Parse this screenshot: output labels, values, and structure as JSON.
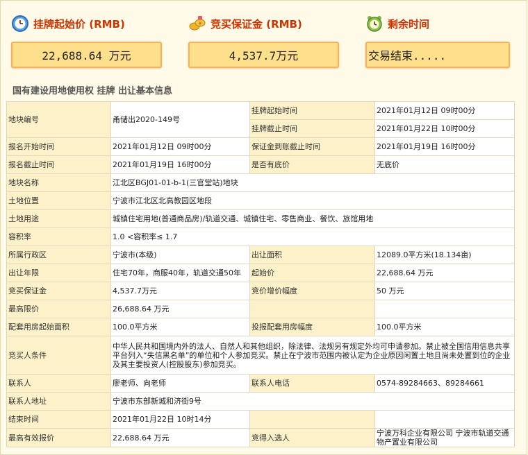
{
  "summary": {
    "start_price_title": "挂牌起始价 (RMB)",
    "start_price_value": "22,688.64 万元",
    "deposit_title": "竞买保证金 (RMB)",
    "deposit_value": "4,537.7万元",
    "remaining_time_title": "剩余时间",
    "remaining_time_value": "交易结束....."
  },
  "section_title": "国有建设用地使用权 挂牌 出让基本信息",
  "rows": {
    "parcel_no_label": "地块编号",
    "parcel_no": "甬储出2020-149号",
    "listing_start_label": "挂牌起始时间",
    "listing_start": "2021年01月12日 09时00分",
    "listing_end_label": "挂牌截止时间",
    "listing_end": "2021年01月22日 10时00分",
    "signup_start_label": "报名开始时间",
    "signup_start": "2021年01月12日 09时00分",
    "deposit_deadline_label": "保证金到账截止时间",
    "deposit_deadline": "2021年01月19日 16时00分",
    "signup_end_label": "报名截止时间",
    "signup_end": "2021年01月19日 16时00分",
    "reserve_label": "是否有底价",
    "reserve": "无底价",
    "parcel_name_label": "地块名称",
    "parcel_name": "江北区BGJ01-01-b-1(三官堂站)地块",
    "location_label": "土地位置",
    "location": "宁波市江北区北高教园区地段",
    "usage_label": "土地用途",
    "usage": "城镇住宅用地(普通商品房)/轨道交通、城镇住宅、零售商业、餐饮、旅馆用地",
    "far_label": "容积率",
    "far": "1.0 <容积率≤ 1.7",
    "district_label": "所属行政区",
    "district": "宁波市(本级)",
    "area_label": "出让面积",
    "area": "12089.0平方米(18.134亩)",
    "term_label": "出让年限",
    "term": "住宅70年，商服40年，轨道交通50年",
    "start_price_label": "起始价",
    "start_price": "22,688.64 万元",
    "bid_deposit_label": "竞买保证金",
    "bid_deposit": "4,537.7万元",
    "increment_label": "竞价增价幅度",
    "increment": "50 万元",
    "max_price_label": "最高限价",
    "max_price": "26,688.64 万元",
    "housing_area_label": "配套用房起始面积",
    "housing_area": "100.0平方米",
    "housing_increment_label": "投报配套用房幅度",
    "housing_increment": "100.0平方米",
    "bidder_conditions_label": "竞买人条件",
    "bidder_conditions": "中华人民共和国境内外的法人、自然人和其他组织，除法律、法规另有规定外均可申请参加。禁止被全国信用信息共享平台列入“失信黑名单”的单位和个人参加竞买。禁止在宁波市范围内被认定为企业原因闲置土地且尚未处置到位的企业及其主要投资人(控股股东)参加竞买。",
    "contact_label": "联系人",
    "contact": "廖老师、向老师",
    "phone_label": "联系人电话",
    "phone": "0574-89284663、89284661",
    "address_label": "联系人地址",
    "address": "宁波市东部新城和济街9号",
    "end_time_label": "结束时间",
    "end_time": "2021年01月22日 10时14分",
    "highest_bid_label": "最高有效报价",
    "highest_bid": "22,688.64 万元",
    "winner_label": "竞得入选人",
    "winner": "宁波万科企业有限公司 宁波市轨道交通物产置业有限公司"
  }
}
